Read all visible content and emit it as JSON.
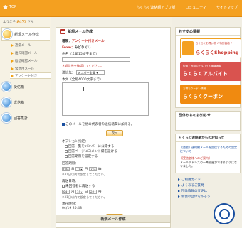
{
  "topbar": {
    "home_label": "TOP",
    "links": [
      "らくらく連絡網アプリ版",
      "コミュニティ",
      "サイトマップ"
    ]
  },
  "sidebar": {
    "welcome_prefix": "ようこそ",
    "welcome_name": "みどり",
    "welcome_suffix": "さん",
    "main_items": [
      {
        "label": "新規メール作成"
      },
      {
        "label": "受信箱"
      },
      {
        "label": "送信箱"
      },
      {
        "label": "回答集計"
      }
    ],
    "sub_items": [
      {
        "label": "通常メール"
      },
      {
        "label": "出欠確認メール"
      },
      {
        "label": "返信確認メール"
      },
      {
        "label": "緊急用メール"
      },
      {
        "label": "アンケート付き"
      }
    ]
  },
  "form": {
    "title": "新規メール作成",
    "type_label": "種類：",
    "type_value": "アンケート付きメール",
    "from_label": "From：",
    "from_value": "みどり (1)",
    "subject_label": "件名（全角15文字まで）",
    "subject_value": "",
    "note_required": "＊返信先を確認してください。",
    "recipient_label": "送信先：",
    "recipient_value": "メンバー全員",
    "body_label": "本文（全角4000文字まで）",
    "body_value": "",
    "copy_checkbox_label": "このメールを他の代表者の送信箱間に加える。",
    "next_button": "次へ",
    "options_label": "オプション指定：",
    "option_items": [
      "回答一覧をメンバーに公開する",
      "回答ページにコメント欄を設ける",
      "回答期限を設定する"
    ],
    "deadline_label": "回答期限：",
    "deadline_month": "04",
    "deadline_day": "19",
    "deadline_hour": "21",
    "deadline_unit_month": "月",
    "deadline_unit_day": "日",
    "deadline_unit_hour": "時",
    "deadline_note": "※31日以内で設定してください。",
    "resend_label": "再送日時：",
    "resend_checkbox": "未回答者に再送する",
    "resend_month": "04",
    "resend_day": "19",
    "resend_hour": "22",
    "resend_note": "※31日以内で設定してください。",
    "current_time_label": "現在時刻：",
    "current_time_value": "04/19 20:48",
    "submit_bar": "次へ",
    "bottom_title": "新規メール作成"
  },
  "right": {
    "recommend_title": "おすすめ情報",
    "ad1_text": "らくらくShopping",
    "ad1_sub": "らくらくお買い物 ♪ 特別価格 ♪",
    "ad2_text": "らくらくアルバイト",
    "ad2_sub": "短期・長期のアルバイト情報満載",
    "ad3_text": "らくらくクーポン",
    "ad3_sub": "お得なクーポン情報",
    "group_notice_title": "団体からのお知らせ",
    "rakuraku_notice_title": "らくらく連絡網からのお知らせ",
    "notice_text_1": "【重要】連絡網メールを受信するための設定について",
    "notice_text_2": "【受信者様へのご案内】",
    "notice_text_3": "メールアドレスの一斉変更ができるようになりました。",
    "links": [
      "ご利用ガイド",
      "よくあるご質問",
      "団体情報の変更は",
      "新会の団体を作ろう"
    ]
  },
  "colors": {
    "topbar": "#f4a020",
    "accent_red": "#c8322a",
    "link_blue": "#1a4fa0"
  }
}
